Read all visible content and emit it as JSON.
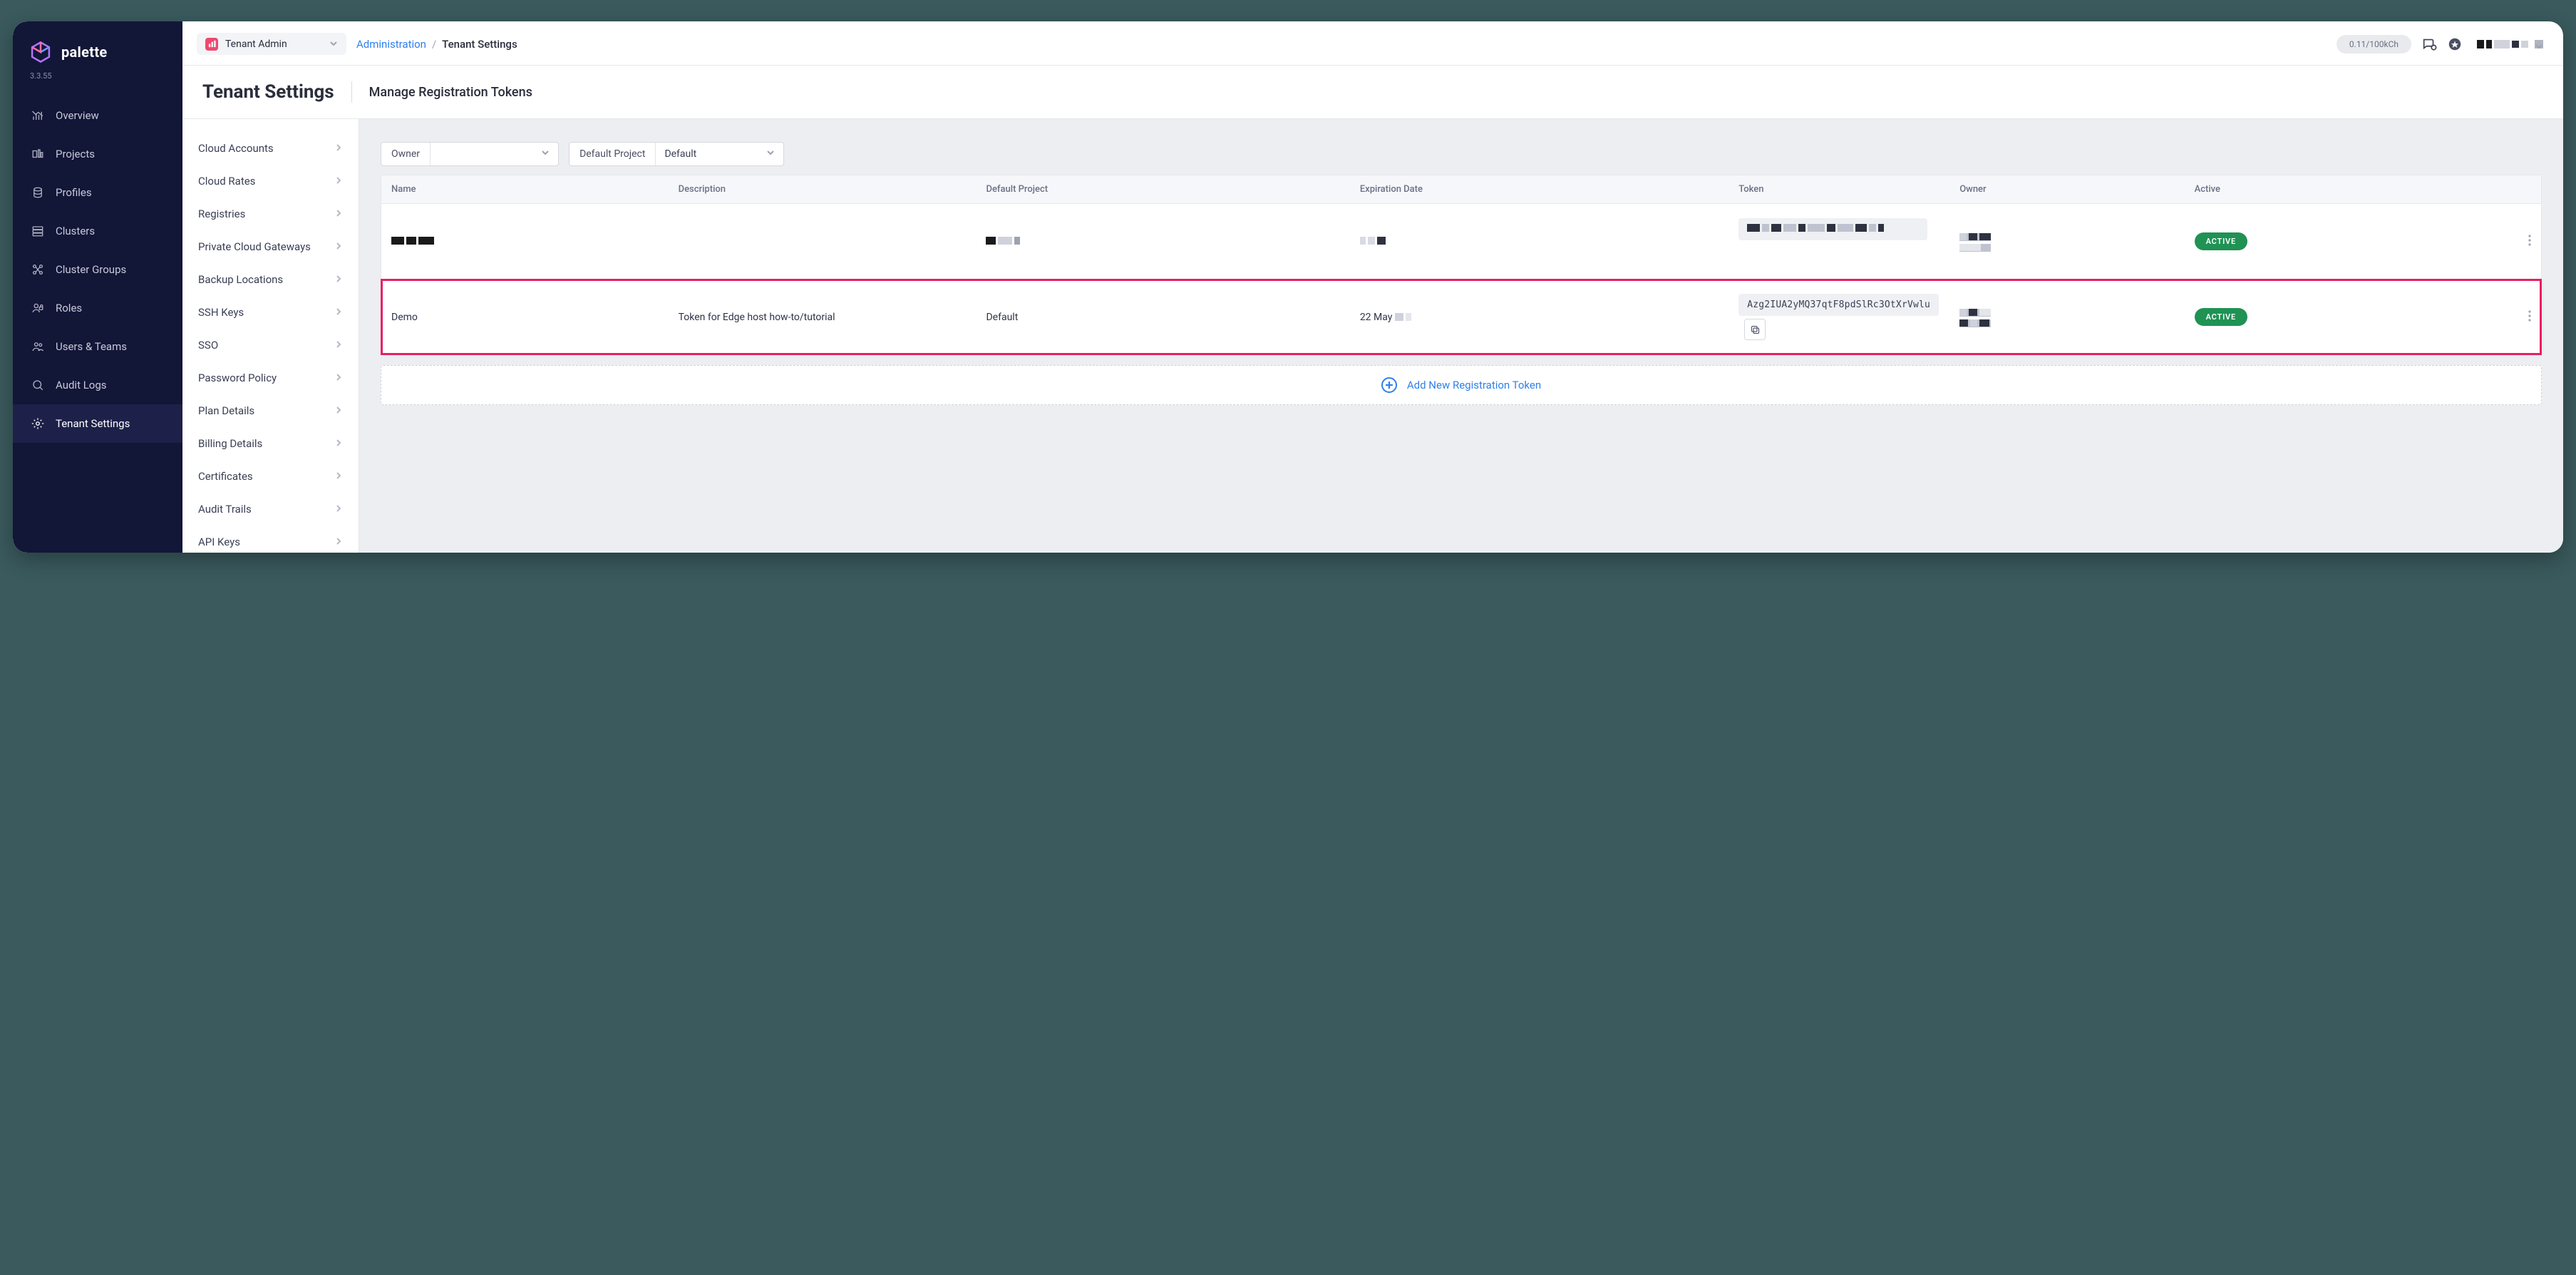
{
  "brand": "palette",
  "version": "3.3.55",
  "sidebar": {
    "items": [
      {
        "icon": "overview",
        "label": "Overview"
      },
      {
        "icon": "projects",
        "label": "Projects"
      },
      {
        "icon": "profiles",
        "label": "Profiles"
      },
      {
        "icon": "clusters",
        "label": "Clusters"
      },
      {
        "icon": "cluster-groups",
        "label": "Cluster Groups"
      },
      {
        "icon": "roles",
        "label": "Roles"
      },
      {
        "icon": "users-teams",
        "label": "Users & Teams"
      },
      {
        "icon": "audit-logs",
        "label": "Audit Logs"
      },
      {
        "icon": "tenant-settings",
        "label": "Tenant Settings"
      }
    ],
    "active_index": 8
  },
  "tenant_selector": {
    "label": "Tenant Admin"
  },
  "breadcrumb": {
    "parent": "Administration",
    "current": "Tenant Settings"
  },
  "usage": "0.11/100kCh",
  "header": {
    "title": "Tenant Settings",
    "subtitle": "Manage Registration Tokens"
  },
  "settings_panel": [
    "Cloud Accounts",
    "Cloud Rates",
    "Registries",
    "Private Cloud Gateways",
    "Backup Locations",
    "SSH Keys",
    "SSO",
    "Password Policy",
    "Plan Details",
    "Billing Details",
    "Certificates",
    "Audit Trails",
    "API Keys"
  ],
  "filters": {
    "owner_label": "Owner",
    "owner_value": "",
    "project_label": "Default Project",
    "project_value": "Default"
  },
  "table": {
    "columns": [
      "Name",
      "Description",
      "Default Project",
      "Expiration Date",
      "Token",
      "Owner",
      "Active"
    ],
    "rows": [
      {
        "name": "[redacted]",
        "description": "",
        "default_project": "[redacted]",
        "expiration": "[redacted]",
        "token": "[redacted]",
        "owner": "[redacted]",
        "active": "ACTIVE",
        "highlight": false
      },
      {
        "name": "Demo",
        "description": "Token for Edge host how-to/tutorial",
        "default_project": "Default",
        "expiration": "22 May",
        "token": "Azg2IUA2yMQ37qtF8pdSlRc3OtXrVwlu",
        "owner": "[redacted]",
        "active": "ACTIVE",
        "highlight": true
      }
    ]
  },
  "add_token_label": "Add New Registration Token"
}
